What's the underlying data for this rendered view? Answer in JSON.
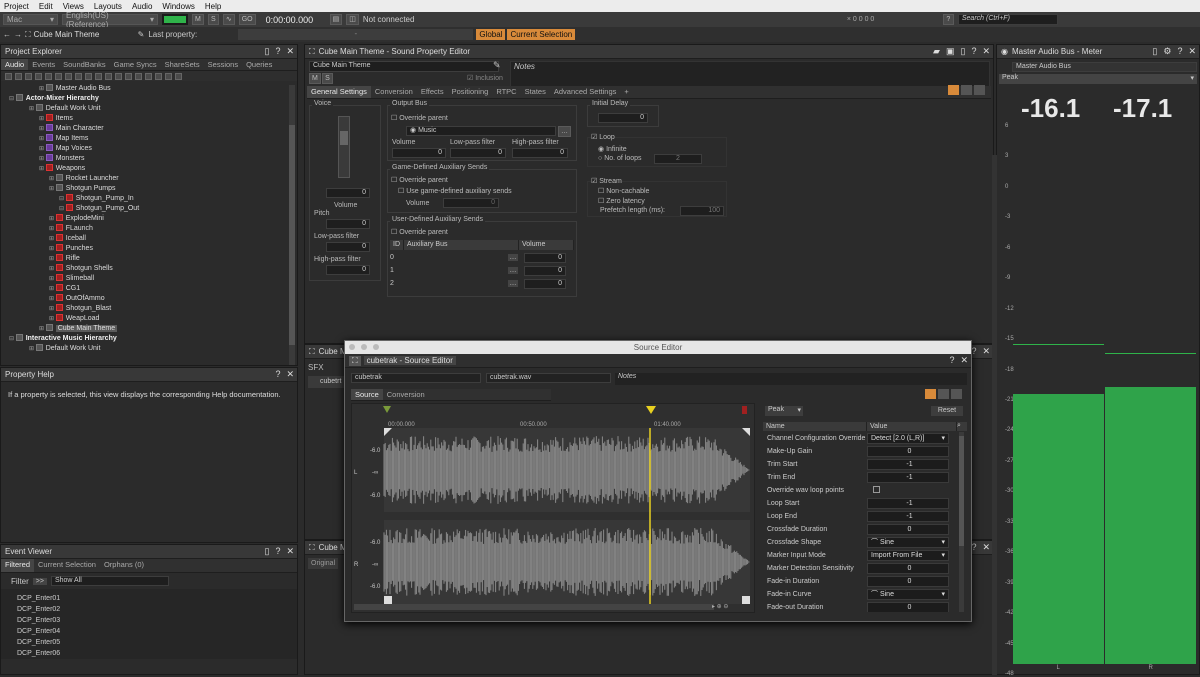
{
  "menu": [
    "Project",
    "Edit",
    "Views",
    "Layouts",
    "Audio",
    "Windows",
    "Help"
  ],
  "toolbar": {
    "platform": "Mac",
    "language": "English(US) (Reference)",
    "m": "M",
    "s": "S",
    "time": "0:00:00.000",
    "status": "Not connected",
    "counts": "0  0  0  0",
    "help": "?",
    "search": "Search (Ctrl+F)"
  },
  "bar2": {
    "object": "Cube Main Theme",
    "last": "Last property:",
    "global": "Global",
    "current": "Current Selection"
  },
  "explorer": {
    "title": "Project Explorer",
    "tabs": [
      "Audio",
      "Events",
      "SoundBanks",
      "Game Syncs",
      "ShareSets",
      "Sessions",
      "Queries"
    ],
    "tree": [
      {
        "t": "Master Audio Bus",
        "lv": 3,
        "b": false
      },
      {
        "t": "Actor-Mixer Hierarchy",
        "lv": 0,
        "b": true
      },
      {
        "t": "Default Work Unit",
        "lv": 2,
        "b": false
      },
      {
        "t": "Items",
        "lv": 3,
        "b": false,
        "c": "red"
      },
      {
        "t": "Main Character",
        "lv": 3,
        "b": false,
        "c": "purp"
      },
      {
        "t": "Map Items",
        "lv": 3,
        "b": false,
        "c": "purp"
      },
      {
        "t": "Map Voices",
        "lv": 3,
        "b": false,
        "c": "purp"
      },
      {
        "t": "Monsters",
        "lv": 3,
        "b": false,
        "c": "purp"
      },
      {
        "t": "Weapons",
        "lv": 3,
        "b": false,
        "c": "red"
      },
      {
        "t": "Rocket Launcher",
        "lv": 4,
        "b": false
      },
      {
        "t": "Shotgun Pumps",
        "lv": 4,
        "b": false
      },
      {
        "t": "Shotgun_Pump_In",
        "lv": 5,
        "b": false,
        "c": "red"
      },
      {
        "t": "Shotgun_Pump_Out",
        "lv": 5,
        "b": false,
        "c": "red"
      },
      {
        "t": "ExplodeMini",
        "lv": 4,
        "b": false,
        "c": "red"
      },
      {
        "t": "FLaunch",
        "lv": 4,
        "b": false,
        "c": "red"
      },
      {
        "t": "Iceball",
        "lv": 4,
        "b": false,
        "c": "red"
      },
      {
        "t": "Punches",
        "lv": 4,
        "b": false,
        "c": "red"
      },
      {
        "t": "Rifle",
        "lv": 4,
        "b": false,
        "c": "red"
      },
      {
        "t": "Shotgun Shells",
        "lv": 4,
        "b": false,
        "c": "red"
      },
      {
        "t": "Slimeball",
        "lv": 4,
        "b": false,
        "c": "red"
      },
      {
        "t": "CG1",
        "lv": 4,
        "b": false,
        "c": "red"
      },
      {
        "t": "OutOfAmmo",
        "lv": 4,
        "b": false,
        "c": "red"
      },
      {
        "t": "Shotgun_Blast",
        "lv": 4,
        "b": false,
        "c": "red"
      },
      {
        "t": "WeapLoad",
        "lv": 4,
        "b": false,
        "c": "red"
      },
      {
        "t": "Cube Main Theme",
        "lv": 3,
        "b": false,
        "sel": true
      },
      {
        "t": "Interactive Music Hierarchy",
        "lv": 0,
        "b": true
      },
      {
        "t": "Default Work Unit",
        "lv": 2,
        "b": false
      }
    ]
  },
  "help": {
    "title": "Property Help",
    "text": "If a property is selected, this view displays the corresponding Help documentation."
  },
  "events": {
    "title": "Event Viewer",
    "tabs": [
      "Filtered",
      "Current Selection",
      "Orphans (0)"
    ],
    "filter": "Filter",
    "show": "Show All",
    "items": [
      "DCP_Enter01",
      "DCP_Enter02",
      "DCP_Enter03",
      "DCP_Enter04",
      "DCP_Enter05",
      "DCP_Enter06"
    ]
  },
  "prop": {
    "title": "Cube Main Theme - Sound Property Editor",
    "name": "Cube Main Theme",
    "notes": "Notes",
    "inclusion": "Inclusion",
    "tabs": [
      "General Settings",
      "Conversion",
      "Effects",
      "Positioning",
      "RTPC",
      "States",
      "Advanced Settings",
      "+"
    ],
    "voice": "Voice",
    "volume": "Volume",
    "pitch": "Pitch",
    "lpf": "Low-pass filter",
    "hpf": "High-pass filter",
    "zero": "0",
    "outputbus": "Output Bus",
    "override": "Override parent",
    "music": "Music",
    "obvol": "Volume",
    "oblpf": "Low-pass filter",
    "obhpf": "High-pass filter",
    "gdas": "Game-Defined Auxiliary Sends",
    "usegd": "Use game-defined auxiliary sends",
    "gdvol": "Volume",
    "udas": "User-Defined Auxiliary Sends",
    "id": "ID",
    "auxbus": "Auxiliary Bus",
    "auxvol": "Volume",
    "rows": [
      "0",
      "1",
      "2"
    ],
    "initdelay": "Initial Delay",
    "loop": "Loop",
    "infinite": "Infinite",
    "noloops": "No. of loops",
    "loopn": "2",
    "stream": "Stream",
    "noncach": "Non-cachable",
    "zerolat": "Zero latency",
    "prefetch": "Prefetch length (ms):",
    "prefetchv": "100"
  },
  "sub": {
    "cube1": "Cube M",
    "sfx": "SFX",
    "cubetrk": "cubetrt",
    "cube2": "Cube M",
    "original": "Original"
  },
  "meter": {
    "title": "Master Audio Bus - Meter",
    "bus": "Master Audio Bus",
    "mode": "Peak",
    "l": "-16.1",
    "r": "-17.1",
    "scale": [
      "6",
      "3",
      "0",
      "-3",
      "-6",
      "-9",
      "-12",
      "-15",
      "-18",
      "-21",
      "-24",
      "-27",
      "-30",
      "-33",
      "-36",
      "-39",
      "-42",
      "-45",
      "-48"
    ],
    "ch": [
      "L",
      "R"
    ],
    "levels": [
      -16.1,
      -17.1
    ],
    "peaks": [
      -12.4,
      -13.1
    ]
  },
  "src": {
    "window": "Source Editor",
    "title": "cubetrak - Source Editor",
    "name": "cubetrak",
    "file": "cubetrak.wav",
    "notes": "Notes",
    "tabs": [
      "Source",
      "Conversion"
    ],
    "t0": "00:00.000",
    "t1": "00:50.000",
    "t2": "01:40.000",
    "db": [
      "-6.0",
      "-∞",
      "-6.0",
      "-6.0",
      "-∞",
      "-6.0"
    ],
    "ch": [
      "L",
      "R"
    ],
    "mode": "Peak",
    "reset": "Reset",
    "hname": "Name",
    "hval": "Value",
    "props": [
      [
        "Channel Configuration Override",
        "Detect [2.0 (L,R)]"
      ],
      [
        "Make-Up Gain",
        "0"
      ],
      [
        "Trim Start",
        "-1"
      ],
      [
        "Trim End",
        "-1"
      ],
      [
        "Override wav loop points",
        ""
      ],
      [
        "Loop Start",
        "-1"
      ],
      [
        "Loop End",
        "-1"
      ],
      [
        "Crossfade Duration",
        "0"
      ],
      [
        "Crossfade Shape",
        "Sine"
      ],
      [
        "Marker Input Mode",
        "Import From File"
      ],
      [
        "Marker Detection Sensitivity",
        "0"
      ],
      [
        "Fade-in Duration",
        "0"
      ],
      [
        "Fade-in Curve",
        "Sine"
      ],
      [
        "Fade-out Duration",
        "0"
      ]
    ]
  }
}
